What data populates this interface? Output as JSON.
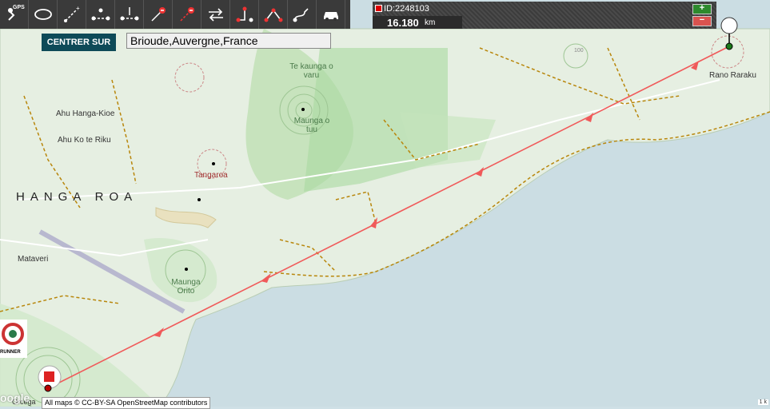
{
  "toolbar": {
    "gps_label": "GPS",
    "tools": [
      "gps-icon",
      "eye-icon",
      "add-point-icon",
      "insert-point-icon",
      "move-point-icon",
      "delete-point-icon",
      "delete-segment-icon",
      "reverse-icon",
      "connect-icon",
      "route-icon",
      "smooth-icon",
      "car-icon"
    ]
  },
  "route": {
    "id_label": "ID:2248103",
    "distance": "16.180",
    "unit": "km",
    "zoom_in": "+",
    "zoom_out": "−"
  },
  "search": {
    "center_label": "CENTRER SUR",
    "address": "Brioude,Auvergne,France"
  },
  "map": {
    "labels": {
      "ahu_hanga_kioe": "Ahu Hanga-Kioe",
      "ahu_ko_te_riku": "Ahu Ko te Riku",
      "hanga_roa": "HANGA ROA",
      "tangaroa": "Tangaroa",
      "mataveri": "Mataveri",
      "maunga_orito": "Maunga Orito",
      "te_kaunga": "Te kaunga o varu",
      "maunga_tuutuu": "Maunga o tuu",
      "rano_raraku": "Rano Raraku",
      "orcega": "Orcega",
      "contour_100": "100"
    },
    "attribution": "All maps © CC-BY-SA OpenStreetMap contributors",
    "google": "oogle",
    "logo_text": "RUNNER",
    "scale": "1 k"
  }
}
